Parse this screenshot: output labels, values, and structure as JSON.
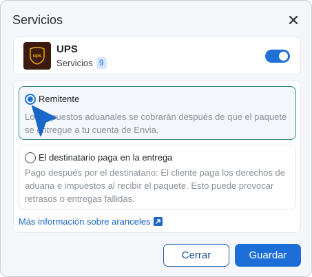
{
  "dialog": {
    "title": "Servicios"
  },
  "carrier": {
    "name": "UPS",
    "services_label": "Servicios",
    "services_count": "9",
    "logo_text": "ups",
    "enabled": true
  },
  "options": [
    {
      "title": "Remitente",
      "description": "Los impuestos aduanales se cobrarán después de que el paquete se entregue a tu cuenta de Envia.",
      "selected": true
    },
    {
      "title": "El destinatario paga en la entrega",
      "description": "Pago después por el destinatario: El cliente paga los derechos de aduana e impuestos al recibir el paquete. Esto puede provocar retrasos o entregas fallidas.",
      "selected": false
    }
  ],
  "more_info_link": "Más información sobre aranceles",
  "buttons": {
    "cancel": "Cerrar",
    "save": "Guardar"
  },
  "colors": {
    "accent": "#1d6fd8",
    "selected_border": "#2f8a79",
    "ups_brown": "#3d1a10",
    "ups_gold": "#f5b400"
  },
  "icons": {
    "close": "close-icon",
    "external": "external-link-icon",
    "cursor": "pointer-cursor"
  }
}
